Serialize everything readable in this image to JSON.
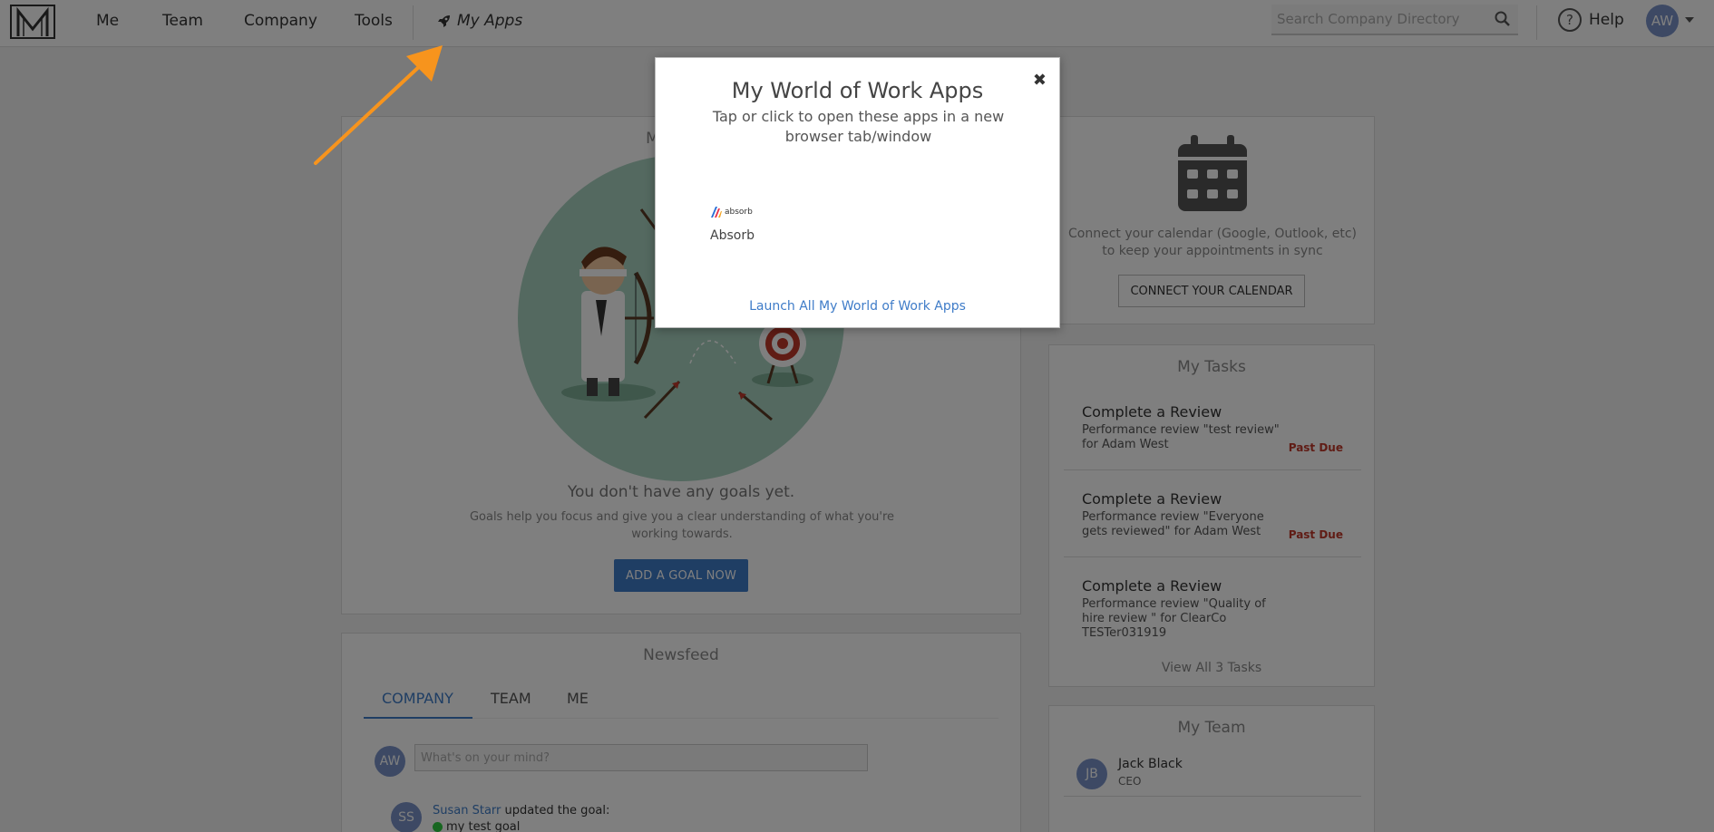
{
  "nav": {
    "items": [
      "Me",
      "Team",
      "Company",
      "Tools"
    ],
    "my_apps": "My Apps",
    "search_placeholder": "Search Company Directory",
    "help": "Help",
    "user_initials": "AW"
  },
  "goals": {
    "title": "My Goals",
    "empty": "You don't have any goals yet.",
    "description": "Goals help you focus and give you a clear understanding of what you're working towards.",
    "button": "ADD A GOAL NOW"
  },
  "calendar": {
    "text": "Connect your calendar (Google, Outlook, etc) to keep your appointments in sync",
    "button": "CONNECT YOUR CALENDAR"
  },
  "tasks": {
    "title": "My Tasks",
    "items": [
      {
        "title": "Complete a Review",
        "desc": "Performance review \"test review\" for Adam West",
        "status": "Past Due"
      },
      {
        "title": "Complete a Review",
        "desc": "Performance review \"Everyone gets reviewed\" for Adam West",
        "status": "Past Due"
      },
      {
        "title": "Complete a Review",
        "desc": "Performance review \"Quality of hire review \" for ClearCo TESTer031919",
        "status": ""
      }
    ],
    "view_all": "View All 3 Tasks"
  },
  "team": {
    "title": "My Team",
    "members": [
      {
        "initials": "JB",
        "name": "Jack Black",
        "role": "CEO"
      }
    ]
  },
  "newsfeed": {
    "title": "Newsfeed",
    "tabs": [
      "COMPANY",
      "TEAM",
      "ME"
    ],
    "active_tab": "COMPANY",
    "post_placeholder": "What's on your mind?",
    "post_avatar": "AW",
    "items": [
      {
        "initials": "SS",
        "user": "Susan Starr",
        "action": "updated the goal:",
        "goal": "my test goal"
      }
    ]
  },
  "modal": {
    "title": "My World of Work Apps",
    "subtitle": "Tap or click to open these apps in a new browser tab/window",
    "apps": [
      {
        "name": "Absorb",
        "logo_text": "absorb"
      }
    ],
    "launch_all": "Launch All My World of Work Apps",
    "close_icon": "close-icon"
  },
  "colors": {
    "accent": "#3f7cc8",
    "past_due": "#c0392b",
    "annotation_arrow": "#f7941d"
  }
}
